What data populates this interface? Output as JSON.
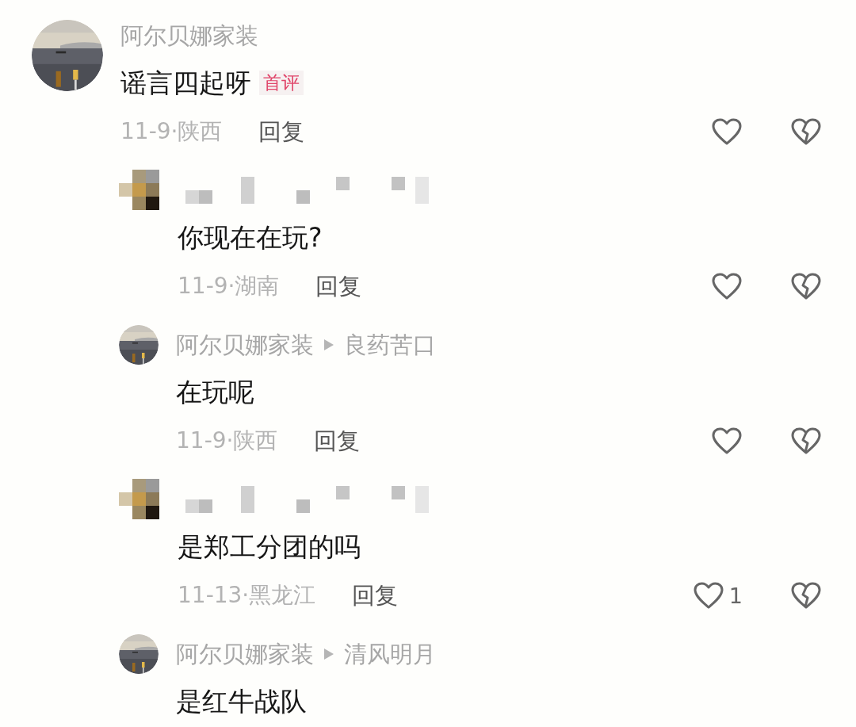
{
  "comments": [
    {
      "kind": "comment",
      "masked": false,
      "author": "阿尔贝娜家装",
      "text": "谣言四起呀",
      "badge": "首评",
      "meta": "11-9·陕西",
      "reply": "回复"
    },
    {
      "kind": "reply",
      "masked": true,
      "text": "你现在在玩?",
      "meta": "11-9·湖南",
      "reply": "回复"
    },
    {
      "kind": "reply",
      "masked": false,
      "author": "阿尔贝娜家装",
      "reply_to": "良药苦口",
      "text": "在玩呢",
      "meta": "11-9·陕西",
      "reply": "回复"
    },
    {
      "kind": "reply",
      "masked": true,
      "text": "是郑工分团的吗",
      "meta": "11-13·黑龙江",
      "reply": "回复",
      "like_count": "1"
    },
    {
      "kind": "reply",
      "masked": false,
      "author": "阿尔贝娜家装",
      "reply_to": "清风明月",
      "text": "是红牛战队"
    }
  ]
}
